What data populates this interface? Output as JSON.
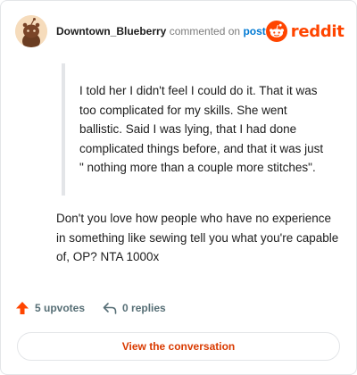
{
  "header": {
    "username": "Downtown_Blueberry",
    "action_text": "commented on",
    "post_link": "post",
    "logo_text": "reddit"
  },
  "quote": {
    "text": "I told her I didn't feel I could do it. That it was too complicated for my skills. She went ballistic. Said I was lying, that I had done complicated things before, and that it was just \" nothing more than a couple more stitches\"."
  },
  "comment": {
    "text": "Don't you love how people who have no experience in something like sewing tell you what you're capable of, OP? NTA 1000x"
  },
  "actions": {
    "upvotes_label": "5 upvotes",
    "replies_label": "0 replies"
  },
  "button": {
    "label": "View the conversation"
  },
  "colors": {
    "brand": "#ff4500",
    "link": "#0079d3",
    "button_text": "#d93a00"
  },
  "icons": {
    "avatar": "snoo-avatar",
    "logo": "reddit-logo-icon",
    "upvote": "upvote-arrow-icon",
    "reply": "reply-icon"
  }
}
